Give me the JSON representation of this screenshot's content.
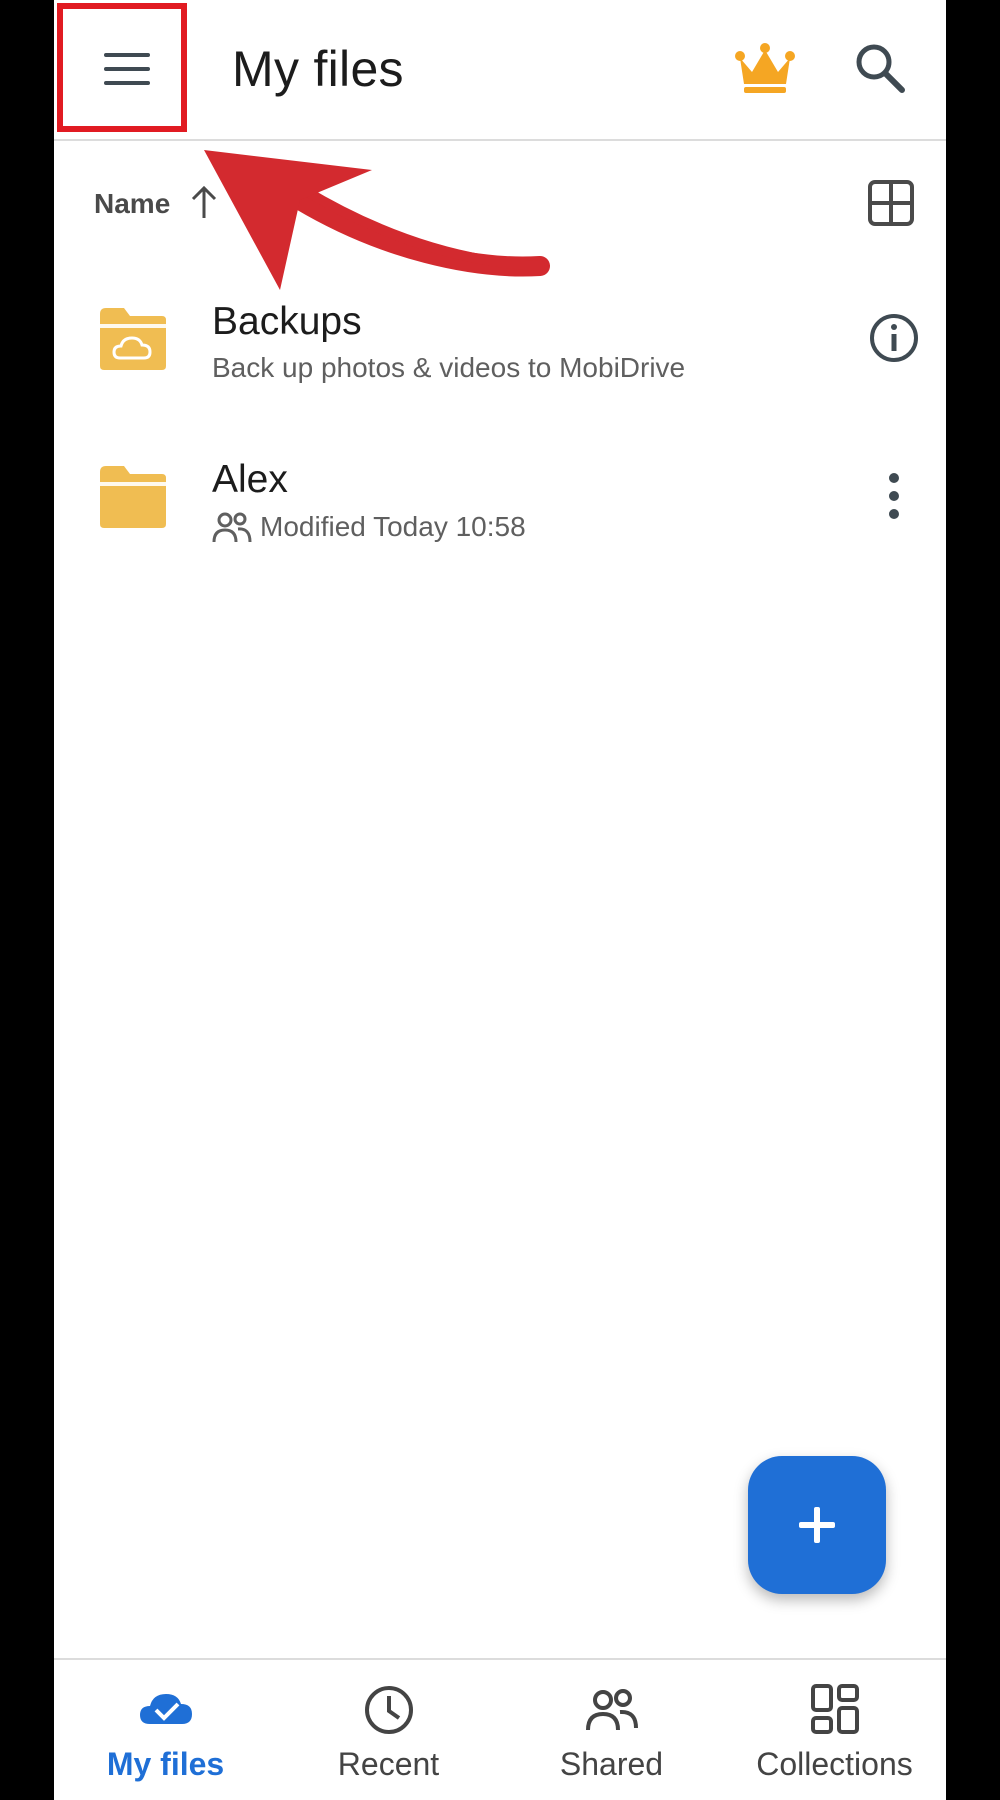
{
  "appbar": {
    "title": "My files",
    "menu_icon": "hamburger-menu-icon",
    "premium_icon": "crown-icon",
    "search_icon": "search-icon"
  },
  "sort": {
    "label": "Name",
    "direction_icon": "arrow-up-icon",
    "view_toggle_icon": "grid-view-icon"
  },
  "files": [
    {
      "name": "Backups",
      "subtitle": "Back up photos & videos to MobiDrive",
      "icon": "cloud-folder-icon",
      "action_icon": "info-icon"
    },
    {
      "name": "Alex",
      "subtitle": "Modified Today 10:58",
      "icon": "folder-icon",
      "shared_icon": "shared-users-icon",
      "action_icon": "more-vertical-icon"
    }
  ],
  "fab": {
    "icon": "plus-icon"
  },
  "bottom_nav": {
    "items": [
      {
        "label": "My files",
        "icon": "cloud-icon",
        "active": true
      },
      {
        "label": "Recent",
        "icon": "clock-icon",
        "active": false
      },
      {
        "label": "Shared",
        "icon": "people-icon",
        "active": false
      },
      {
        "label": "Collections",
        "icon": "collections-icon",
        "active": false
      }
    ]
  },
  "colors": {
    "accent": "#1f6fd6",
    "folder": "#f0bd52",
    "crown": "#f5a623",
    "annotation": "#d32a2f",
    "highlight": "#e11b22"
  }
}
